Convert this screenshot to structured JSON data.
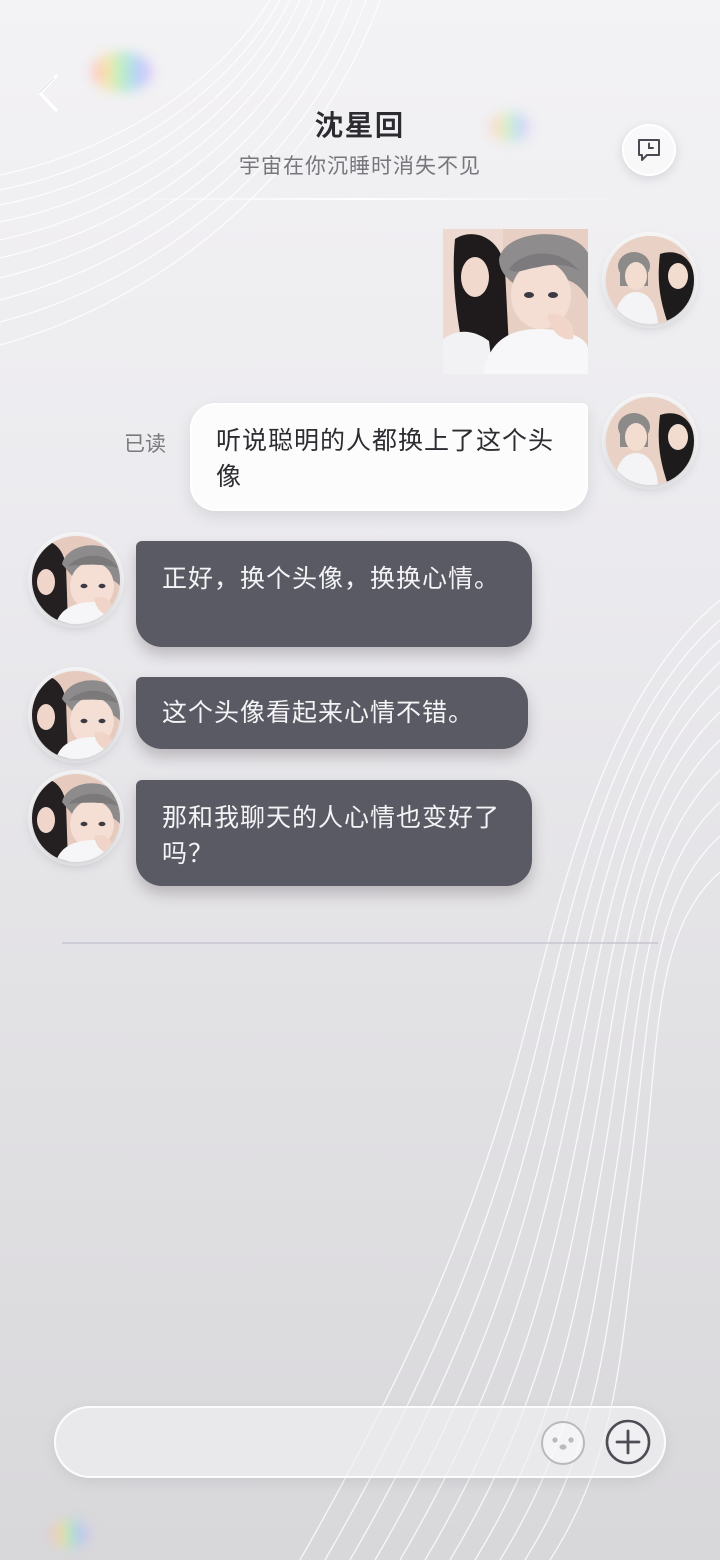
{
  "header": {
    "title": "沈星回",
    "subtitle": "宇宙在你沉睡时消失不见"
  },
  "icons": {
    "back": "chevron-left-icon",
    "history": "chat-history-clock-icon",
    "emoji": "emoji-face-icon",
    "plus": "plus-circle-icon"
  },
  "messages": [
    {
      "from": "me",
      "type": "image",
      "alt": ""
    },
    {
      "from": "me",
      "type": "text",
      "status": "已读",
      "text": "听说聪明的人都换上了这个头像"
    },
    {
      "from": "contact",
      "type": "text",
      "text": "正好，换个头像，换换心情。"
    },
    {
      "from": "contact",
      "type": "text",
      "text": "这个头像看起来心情不错。"
    },
    {
      "from": "contact",
      "type": "text",
      "text": "那和我聊天的人心情也变好了吗？"
    }
  ],
  "input": {
    "placeholder": ""
  },
  "colors": {
    "incoming_bubble": "#5a5a64",
    "outgoing_bubble": "#fcfcfd",
    "title": "#2b2b30",
    "subtitle": "#77767c"
  }
}
